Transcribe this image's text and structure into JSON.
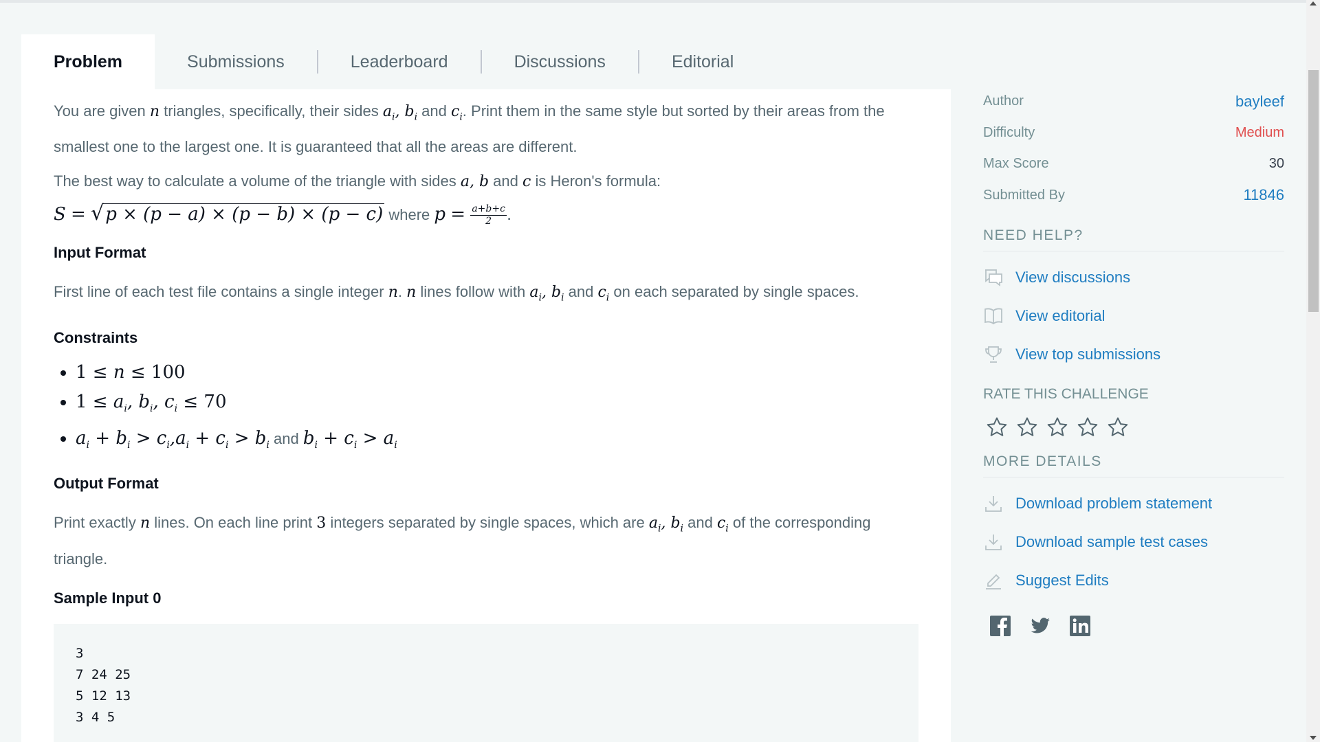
{
  "tabs": [
    {
      "label": "Problem",
      "active": true
    },
    {
      "label": "Submissions"
    },
    {
      "label": "Leaderboard"
    },
    {
      "label": "Discussions"
    },
    {
      "label": "Editorial"
    }
  ],
  "problem": {
    "p1a": "You are given ",
    "p1b": " triangles, specifically, their sides ",
    "p1c": " and ",
    "p1d": ". Print them in the same style but sorted by their areas from the smallest one to the largest one. It is guaranteed that all the areas are different.",
    "p2a": "The best way to calculate a volume of the triangle with sides ",
    "p2b": " and ",
    "p2c": " is Heron's formula:",
    "formula_where": " where ",
    "input_heading": "Input Format",
    "in_a": "First line of each test file contains a single integer ",
    "in_b": " lines follow with ",
    "in_c": " and ",
    "in_d": " on each separated by single spaces.",
    "constraints_heading": "Constraints",
    "and_word": " and ",
    "output_heading": "Output Format",
    "out_a": "Print exactly ",
    "out_b": " lines. On each line print ",
    "out_c": " integers separated by single spaces, which are ",
    "out_d": " and ",
    "out_e": " of the corresponding triangle.",
    "sample_heading": "Sample Input 0",
    "sample_input": "3\n7 24 25\n5 12 13\n3 4 5"
  },
  "sidebar": {
    "meta": [
      {
        "label": "Author",
        "value": "bayleef"
      },
      {
        "label": "Difficulty",
        "value": "Medium"
      },
      {
        "label": "Max Score",
        "value": "30"
      },
      {
        "label": "Submitted By",
        "value": "11846"
      }
    ],
    "need_help_title": "NEED HELP?",
    "help_links": [
      {
        "label": "View discussions",
        "icon": "discussions-icon"
      },
      {
        "label": "View editorial",
        "icon": "book-icon"
      },
      {
        "label": "View top submissions",
        "icon": "trophy-icon"
      }
    ],
    "rate_title": "RATE THIS CHALLENGE",
    "rating": 0,
    "rating_max": 5,
    "more_details_title": "MORE DETAILS",
    "detail_links": [
      {
        "label": "Download problem statement",
        "icon": "download-icon"
      },
      {
        "label": "Download sample test cases",
        "icon": "download-icon"
      },
      {
        "label": "Suggest Edits",
        "icon": "pencil-icon"
      }
    ],
    "social": [
      "facebook-icon",
      "twitter-icon",
      "linkedin-icon"
    ]
  },
  "colors": {
    "link": "#1f7dc1",
    "difficulty_medium": "#e04f4f",
    "background": "#f3f7f7"
  }
}
